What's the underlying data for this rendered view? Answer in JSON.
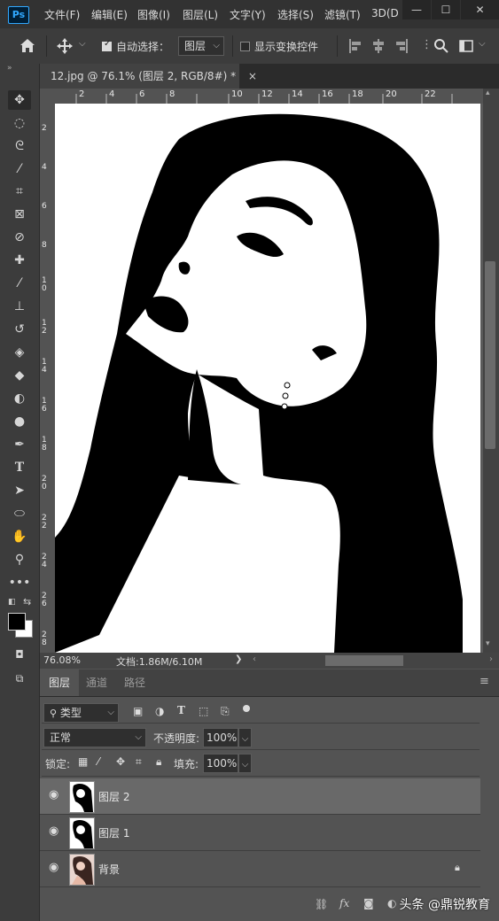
{
  "app": {
    "logo": "Ps"
  },
  "menu": [
    "文件(F)",
    "编辑(E)",
    "图像(I)",
    "图层(L)",
    "文字(Y)",
    "选择(S)",
    "滤镜(T)",
    "3D(D"
  ],
  "window_controls": [
    "—",
    "☐",
    "✕"
  ],
  "options_bar": {
    "auto_select_label": "自动选择：",
    "auto_select_checked": true,
    "auto_select_target": "图层",
    "show_transform_label": "显示变换控件",
    "show_transform_checked": false
  },
  "document": {
    "tab_title": "12.jpg @ 76.1% (图层 2, RGB/8#) *",
    "close_glyph": "×"
  },
  "ruler_top": [
    "2",
    "4",
    "6",
    "8",
    "10",
    "12",
    "14",
    "16",
    "18",
    "20",
    "22"
  ],
  "ruler_left": [
    "2",
    "4",
    "6",
    "8",
    "1\n0",
    "1\n2",
    "1\n4",
    "1\n6",
    "1\n8",
    "2\n0",
    "2\n2",
    "2\n4",
    "2\n6",
    "2\n8"
  ],
  "status_bar": {
    "zoom": "76.08%",
    "doc_info": "文档:1.86M/6.10M",
    "arrow": "❯"
  },
  "layers_panel": {
    "tabs": [
      "图层",
      "通道",
      "路径"
    ],
    "active_tab": 0,
    "filter_type": "类型",
    "blend_mode": "正常",
    "opacity_label": "不透明度:",
    "opacity_value": "100%",
    "lock_label": "锁定:",
    "fill_label": "填充:",
    "fill_value": "100%",
    "layers": [
      {
        "name": "图层 2",
        "selected": true,
        "locked": false
      },
      {
        "name": "图层 1",
        "selected": false,
        "locked": false
      },
      {
        "name": "背景",
        "selected": false,
        "locked": true
      }
    ],
    "footer_icons": [
      "link-icon",
      "fx-icon",
      "mask-icon",
      "adjustment-icon"
    ]
  },
  "watermark": "头条 @鼎锐教育",
  "colors": {
    "accent": "#31a8ff",
    "foreground": "#000000",
    "background": "#ffffff"
  }
}
